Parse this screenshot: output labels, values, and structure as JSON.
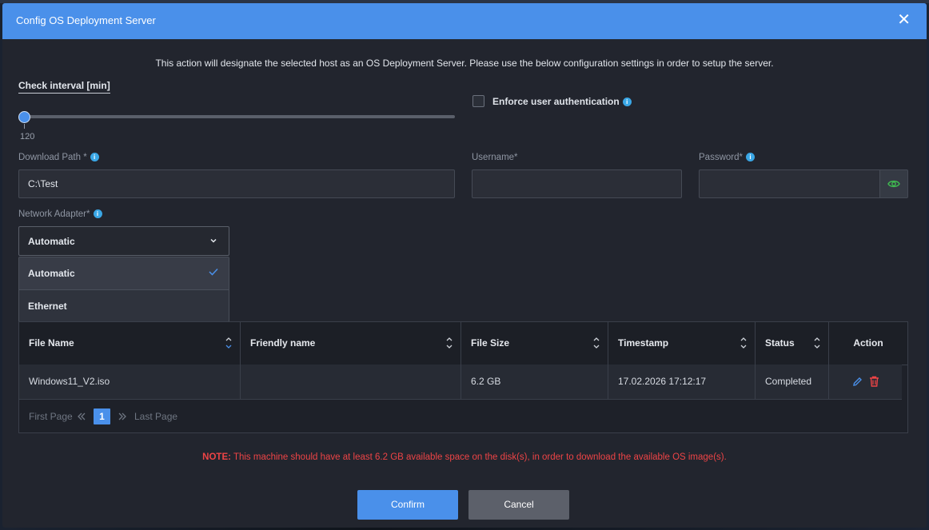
{
  "dialog": {
    "title": "Config OS Deployment Server",
    "close_symbol": "✕",
    "description": "This action will designate the selected host as an OS Deployment Server. Please use the below configuration settings in order to setup the server."
  },
  "interval": {
    "label": "Check interval [min]",
    "value": "120",
    "fill_fraction": 0
  },
  "auth": {
    "label": "Enforce user authentication",
    "checked": false
  },
  "fields": {
    "download_path": {
      "label": "Download Path *",
      "value": "C:\\Test"
    },
    "username": {
      "label": "Username*",
      "value": ""
    },
    "password": {
      "label": "Password*",
      "value": ""
    },
    "network_adapter": {
      "label": "Network Adapter*",
      "selected": "Automatic",
      "options": [
        "Automatic",
        "Ethernet"
      ]
    }
  },
  "table": {
    "columns": [
      "File Name",
      "Friendly name",
      "File Size",
      "Timestamp",
      "Status",
      "Action"
    ],
    "rows": [
      {
        "file_name": "Windows11_V2.iso",
        "friendly_name": "",
        "file_size": "6.2 GB",
        "timestamp": "17.02.2026  17:12:17",
        "status": "Completed"
      }
    ]
  },
  "pager": {
    "first": "First Page",
    "current": "1",
    "last": "Last Page"
  },
  "note": {
    "prefix": "NOTE:",
    "text": " This machine should have at least 6.2 GB available space on the disk(s), in order to download the available OS image(s)."
  },
  "buttons": {
    "confirm": "Confirm",
    "cancel": "Cancel"
  },
  "colors": {
    "accent": "#4a90ea",
    "danger": "#ee4446",
    "info": "#3aa7e6",
    "eye": "#3fb950"
  }
}
